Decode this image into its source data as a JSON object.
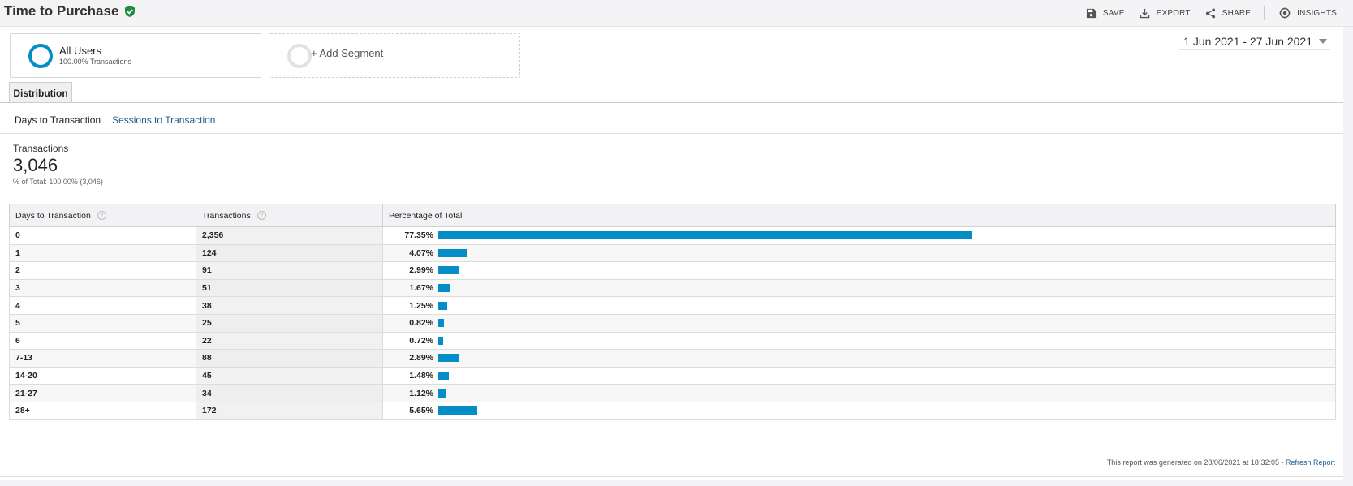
{
  "header": {
    "title": "Time to Purchase",
    "actions": [
      {
        "label": "SAVE",
        "icon": "save-icon"
      },
      {
        "label": "EXPORT",
        "icon": "export-icon"
      },
      {
        "label": "SHARE",
        "icon": "share-icon"
      },
      {
        "label": "INSIGHTS",
        "icon": "insights-icon"
      }
    ]
  },
  "segments": {
    "primary": {
      "name": "All Users",
      "sub": "100.00% Transactions"
    },
    "add_label": "+ Add Segment"
  },
  "date_range": "1 Jun 2021 - 27 Jun 2021",
  "tabs": {
    "distribution": "Distribution"
  },
  "subnav": {
    "active": "Days to Transaction",
    "link": "Sessions to Transaction"
  },
  "metric": {
    "label": "Transactions",
    "value": "3,046",
    "sub": "% of Total: 100.00% (3,046)"
  },
  "table": {
    "headers": [
      "Days to Transaction",
      "Transactions",
      "Percentage of Total"
    ],
    "rows": [
      {
        "days": "0",
        "transactions": "2,356",
        "pct_label": "77.35%",
        "pct": 77.35
      },
      {
        "days": "1",
        "transactions": "124",
        "pct_label": "4.07%",
        "pct": 4.07
      },
      {
        "days": "2",
        "transactions": "91",
        "pct_label": "2.99%",
        "pct": 2.99
      },
      {
        "days": "3",
        "transactions": "51",
        "pct_label": "1.67%",
        "pct": 1.67
      },
      {
        "days": "4",
        "transactions": "38",
        "pct_label": "1.25%",
        "pct": 1.25
      },
      {
        "days": "5",
        "transactions": "25",
        "pct_label": "0.82%",
        "pct": 0.82
      },
      {
        "days": "6",
        "transactions": "22",
        "pct_label": "0.72%",
        "pct": 0.72
      },
      {
        "days": "7-13",
        "transactions": "88",
        "pct_label": "2.89%",
        "pct": 2.89
      },
      {
        "days": "14-20",
        "transactions": "45",
        "pct_label": "1.48%",
        "pct": 1.48
      },
      {
        "days": "21-27",
        "transactions": "34",
        "pct_label": "1.12%",
        "pct": 1.12
      },
      {
        "days": "28+",
        "transactions": "172",
        "pct_label": "5.65%",
        "pct": 5.65
      }
    ]
  },
  "footer": {
    "text": "This report was generated on 28/06/2021 at 18:32:05 - ",
    "refresh": "Refresh Report"
  },
  "colors": {
    "accent": "#058dc7",
    "verified": "#1e8e3e",
    "link": "#1f5b8f"
  }
}
